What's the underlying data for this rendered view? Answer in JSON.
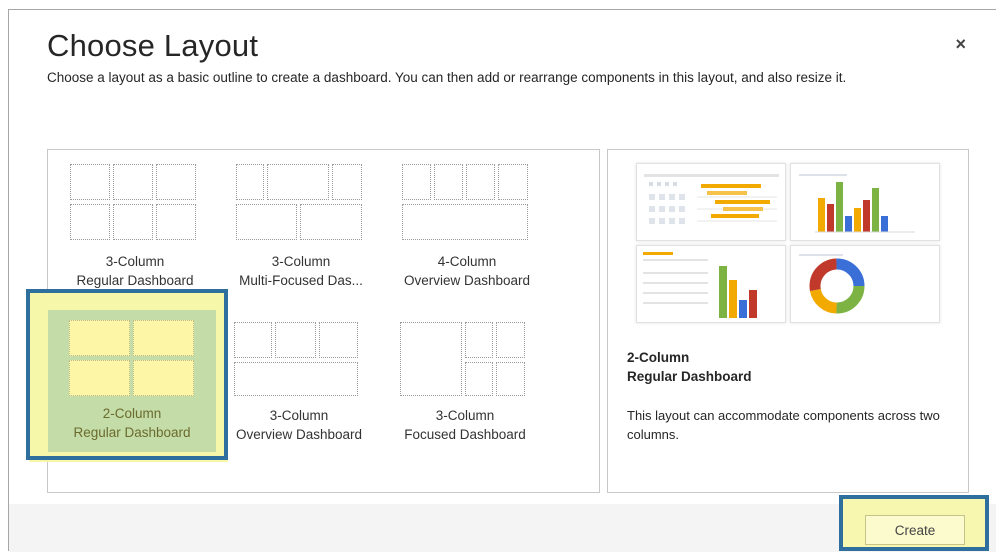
{
  "dialog": {
    "title": "Choose Layout",
    "close_glyph": "×",
    "subtitle": "Choose a layout as a basic outline to create a dashboard. You can then add or rearrange components in this layout, and also resize it."
  },
  "layouts": [
    {
      "line1": "3-Column",
      "line2": "Regular Dashboard",
      "selected": false
    },
    {
      "line1": "3-Column",
      "line2": "Multi-Focused Das...",
      "selected": false
    },
    {
      "line1": "4-Column",
      "line2": "Overview Dashboard",
      "selected": false
    },
    {
      "line1": "2-Column",
      "line2": "Regular Dashboard",
      "selected": true
    },
    {
      "line1": "3-Column",
      "line2": "Overview Dashboard",
      "selected": false
    },
    {
      "line1": "3-Column",
      "line2": "Focused Dashboard",
      "selected": false
    }
  ],
  "preview": {
    "name_line1": "2-Column",
    "name_line2": "Regular Dashboard",
    "description": "This layout can accommodate components across two columns."
  },
  "footer": {
    "create_label": "Create"
  },
  "colors": {
    "selection_border": "#2e6f9e",
    "selection_highlight": "#f6f7a8",
    "selected_tile_bg": "#c4dca8",
    "bar_orange": "#f2a900",
    "bar_red": "#c0392b",
    "bar_green": "#7cb342",
    "bar_blue": "#3a6fd8"
  },
  "icons": {
    "close": "close-icon"
  }
}
